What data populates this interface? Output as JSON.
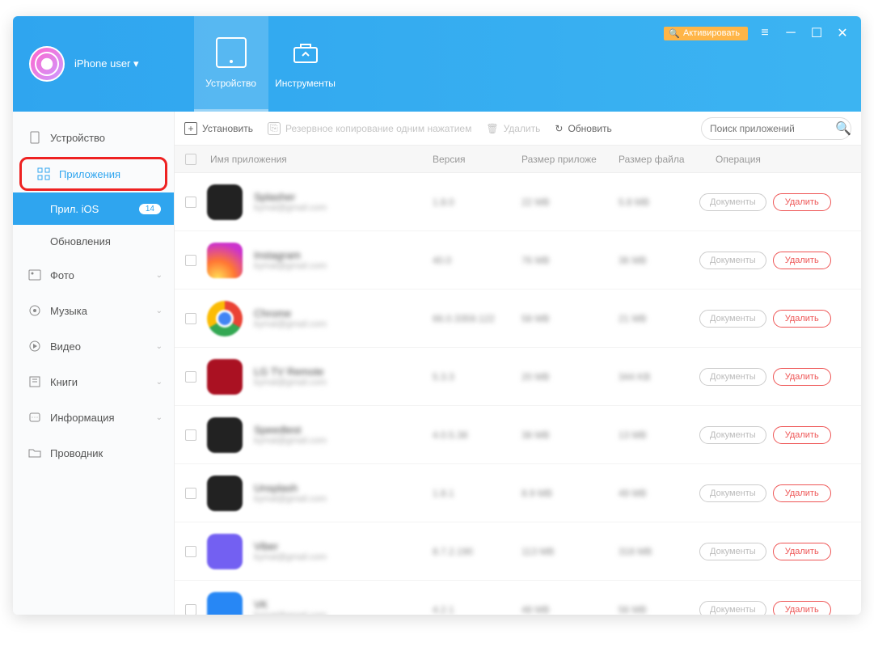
{
  "header": {
    "user_label": "iPhone user ▾",
    "tab_device": "Устройство",
    "tab_tools": "Инструменты",
    "activate": "Активировать"
  },
  "sidebar": {
    "device": "Устройство",
    "apps": "Приложения",
    "apps_ios": "Прил. iOS",
    "apps_ios_badge": "14",
    "updates": "Обновления",
    "photo": "Фото",
    "music": "Музыка",
    "video": "Видео",
    "books": "Книги",
    "info": "Информация",
    "explorer": "Проводник"
  },
  "toolbar": {
    "install": "Установить",
    "backup": "Резервное копирование одним нажатием",
    "delete": "Удалить",
    "refresh": "Обновить",
    "search_placeholder": "Поиск приложений"
  },
  "table": {
    "h_name": "Имя приложения",
    "h_ver": "Версия",
    "h_psz": "Размер приложе",
    "h_fsz": "Размер файла",
    "h_op": "Операция",
    "btn_doc": "Документы",
    "btn_del": "Удалить",
    "rows": [
      {
        "name": "Splasher",
        "sub": "kymal@gmail.com",
        "ver": "1.8.0",
        "psz": "22 MB",
        "fsz": "5.8 MB",
        "icon": "ico-grid"
      },
      {
        "name": "Instagram",
        "sub": "kymal@gmail.com",
        "ver": "40.0",
        "psz": "76 MB",
        "fsz": "36 MB",
        "icon": "ico-ig"
      },
      {
        "name": "Chrome",
        "sub": "kymal@gmail.com",
        "ver": "66.0.3359.122",
        "psz": "58 MB",
        "fsz": "21 MB",
        "icon": "ico-chrome"
      },
      {
        "name": "LG TV Remote",
        "sub": "kymal@gmail.com",
        "ver": "5.3.3",
        "psz": "20 MB",
        "fsz": "344 KB",
        "icon": "ico-lg"
      },
      {
        "name": "Speedtest",
        "sub": "kymal@gmail.com",
        "ver": "4.0.5.38",
        "psz": "38 MB",
        "fsz": "13 MB",
        "icon": "ico-speed"
      },
      {
        "name": "Unsplash",
        "sub": "kymal@gmail.com",
        "ver": "1.8.1",
        "psz": "8.9 MB",
        "fsz": "49 MB",
        "icon": "ico-unsplash"
      },
      {
        "name": "Viber",
        "sub": "kymal@gmail.com",
        "ver": "8.7.2.190",
        "psz": "113 MB",
        "fsz": "318 MB",
        "icon": "ico-viber"
      },
      {
        "name": "VK",
        "sub": "kymal@gmail.com",
        "ver": "4.2.1",
        "psz": "48 MB",
        "fsz": "56 MB",
        "icon": "ico-vk"
      }
    ]
  }
}
